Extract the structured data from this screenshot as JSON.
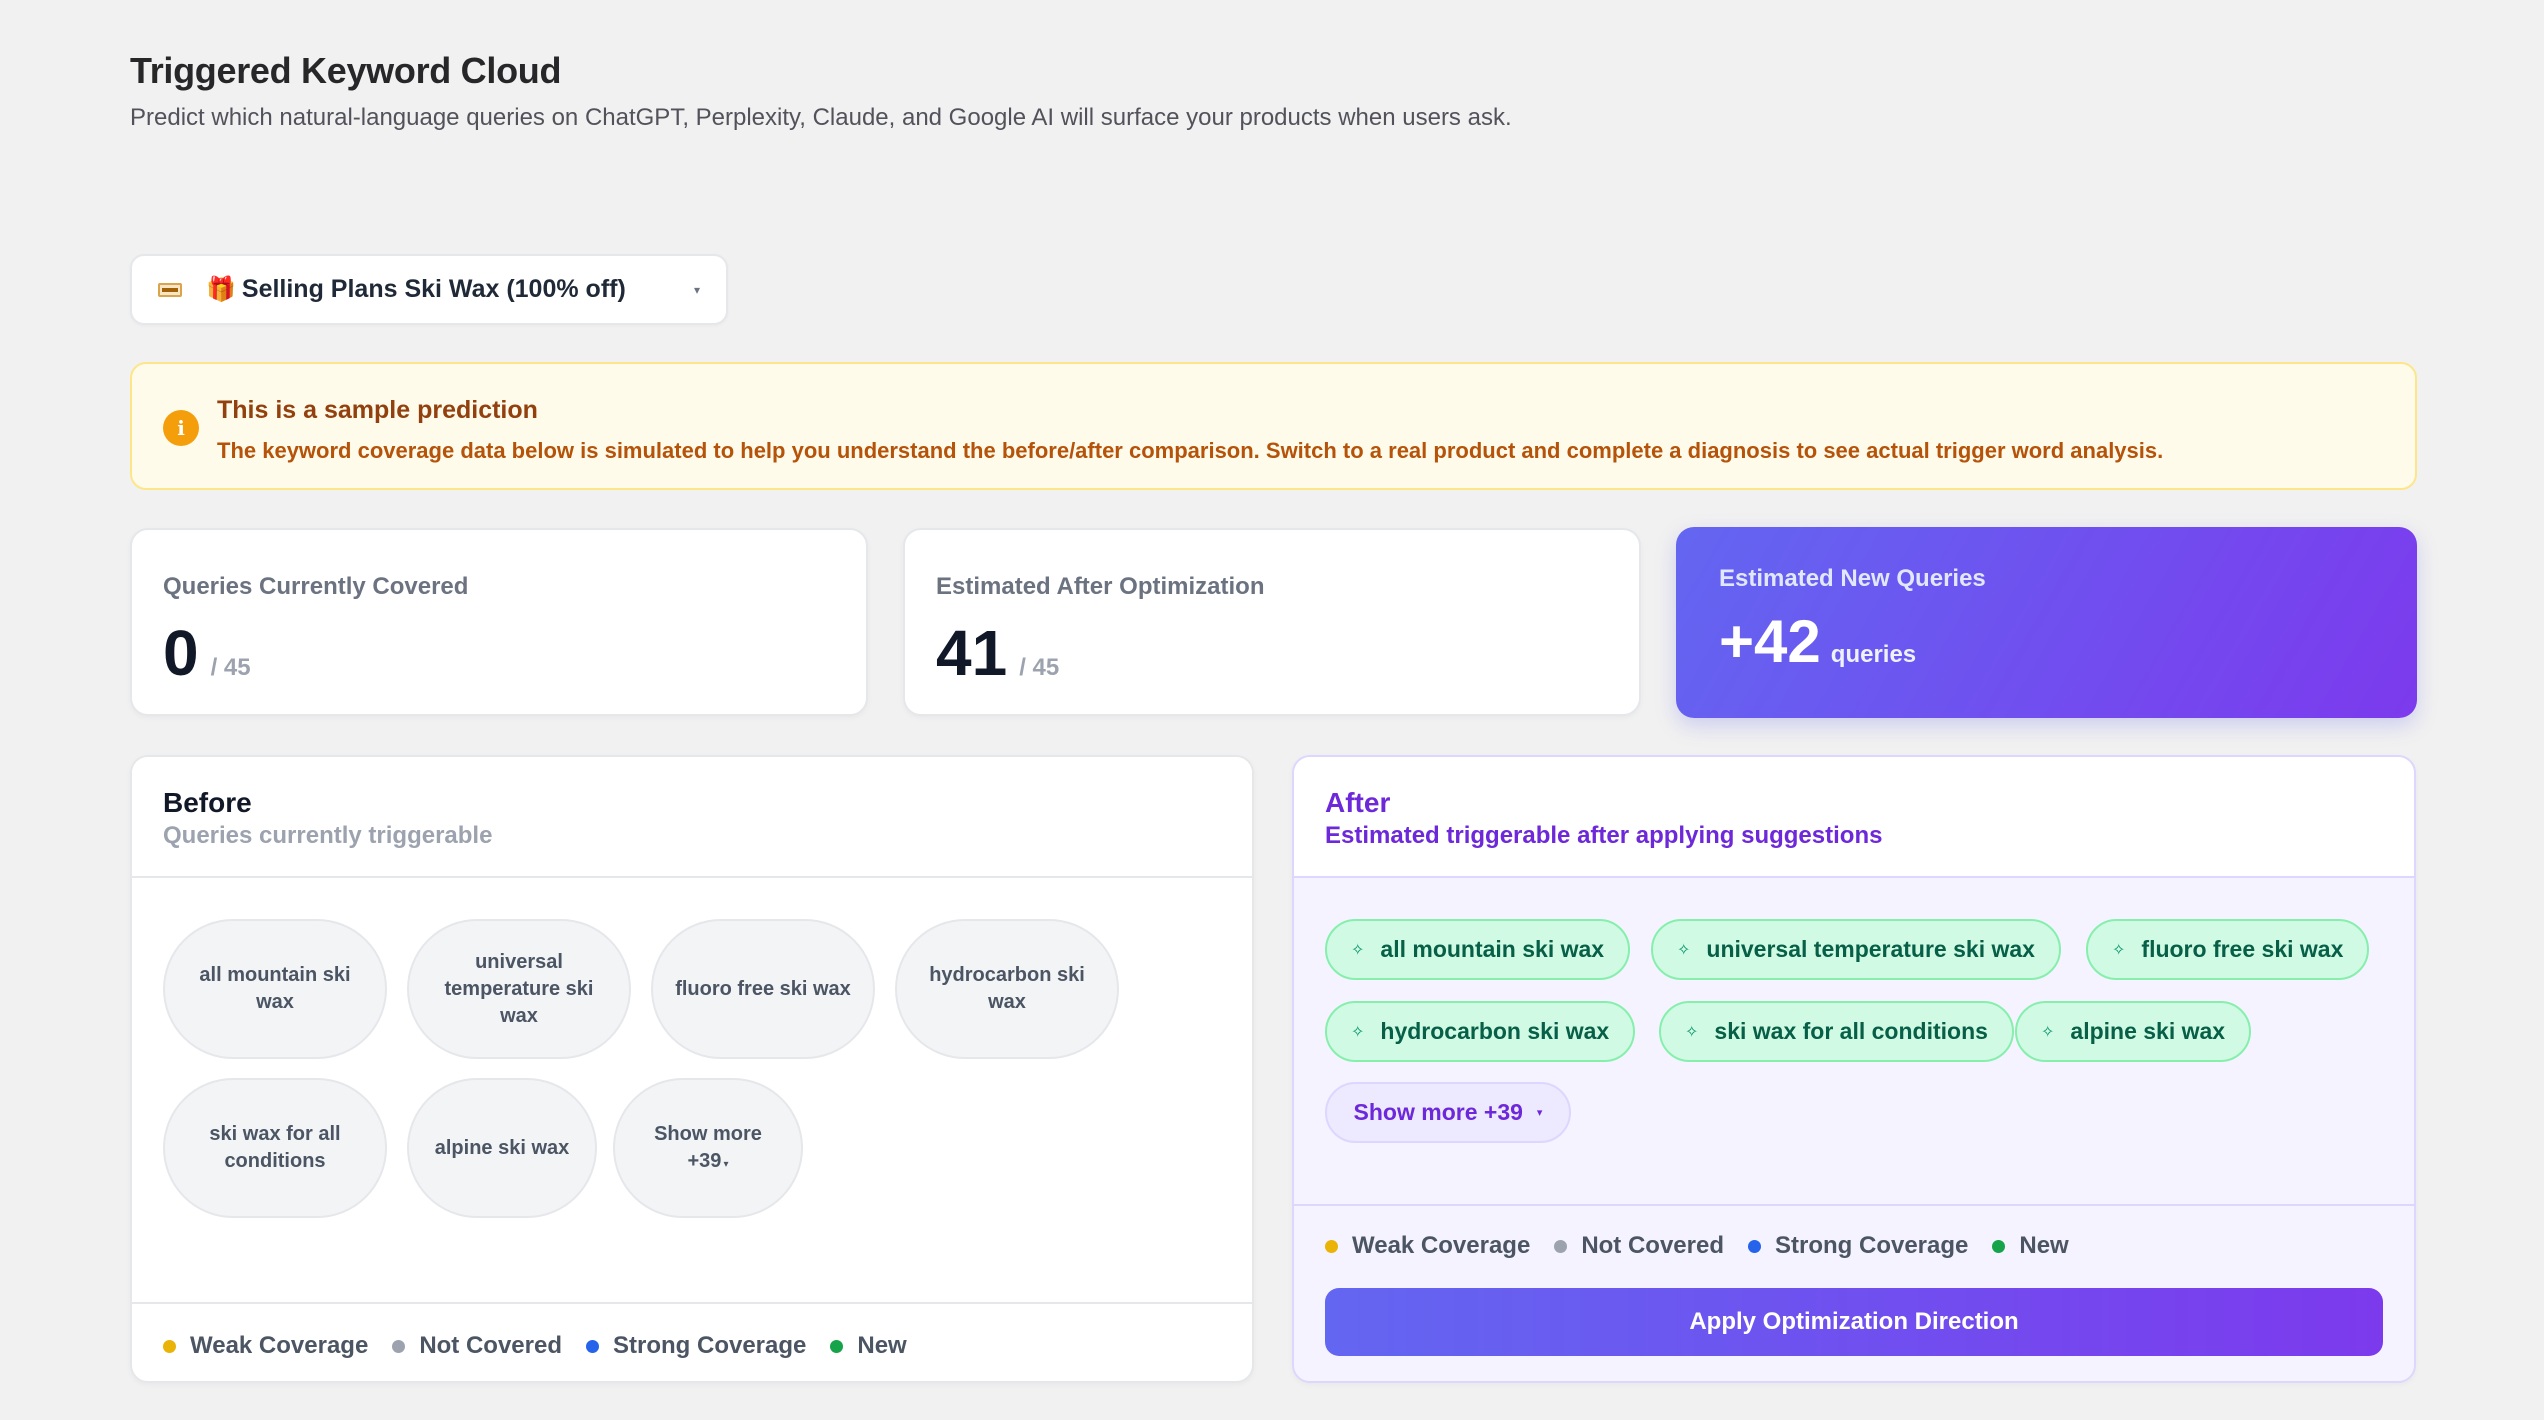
{
  "header": {
    "title": "Triggered Keyword Cloud",
    "subtitle": "Predict which natural-language queries on ChatGPT, Perplexity, Claude, and Google AI will surface your products when users ask."
  },
  "product_selector": {
    "icon": "gift-icon",
    "gift_glyph": "🎁",
    "label": "Selling Plans Ski Wax (100% off)",
    "caret": "▾"
  },
  "notice": {
    "icon_glyph": "i",
    "title": "This is a sample prediction",
    "body": "The keyword coverage data below is simulated to help you understand the before/after comparison. Switch to a real product and complete a diagnosis to see actual trigger word analysis."
  },
  "stats": {
    "covered": {
      "label": "Queries Currently Covered",
      "value": "0",
      "total": "/ 45"
    },
    "after": {
      "label": "Estimated After Optimization",
      "value": "41",
      "total": "/ 45"
    },
    "new": {
      "label": "Estimated New Queries",
      "value": "+42",
      "unit": "queries"
    }
  },
  "before_panel": {
    "title": "Before",
    "subtitle": "Queries currently triggerable",
    "keywords": [
      "all mountain ski wax",
      "universal temperature ski wax",
      "fluoro free ski wax",
      "hydrocarbon ski wax",
      "ski wax for all conditions",
      "alpine ski wax"
    ],
    "show_more_line1": "Show more",
    "show_more_line2": "+39",
    "caret": "▾"
  },
  "after_panel": {
    "title": "After",
    "subtitle": "Estimated triggerable after applying suggestions",
    "keywords": [
      "all mountain ski wax",
      "universal temperature ski wax",
      "fluoro free ski wax",
      "hydrocarbon ski wax",
      "ski wax for all conditions",
      "alpine ski wax"
    ],
    "spark_glyph": "✧",
    "show_more": "Show more +39",
    "caret": "▾",
    "apply_label": "Apply Optimization Direction"
  },
  "legend": {
    "weak": {
      "label": "Weak Coverage",
      "color": "#eab308"
    },
    "not_covered": {
      "label": "Not Covered",
      "color": "#9ca3af"
    },
    "strong": {
      "label": "Strong Coverage",
      "color": "#2563eb"
    },
    "new": {
      "label": "New",
      "color": "#16a34a"
    }
  }
}
